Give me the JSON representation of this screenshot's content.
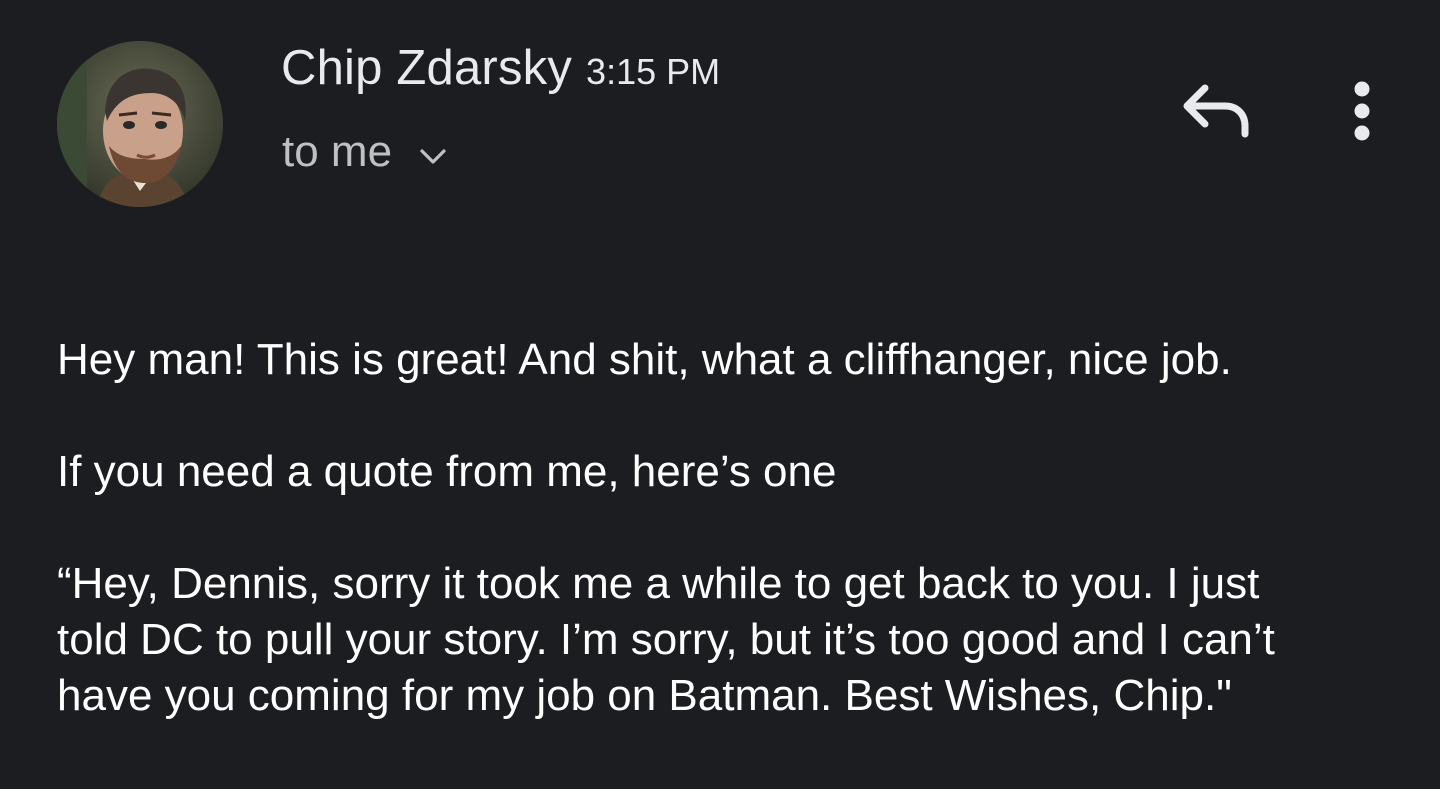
{
  "header": {
    "sender_name": "Chip Zdarsky",
    "time": "3:15 PM",
    "recipient": "to me",
    "avatar_icon": "avatar-photo",
    "chevron_icon": "chevron-down-icon",
    "reply_icon": "reply-icon",
    "more_icon": "more-vertical-icon"
  },
  "message": {
    "paragraph_1": "Hey man! This is great! And shit, what a cliffhanger, nice job.",
    "paragraph_2": "If you need a quote from me, here’s one",
    "paragraph_3_line_1": "“Hey, Dennis, sorry it took me a while to get back to you. I just",
    "paragraph_3_line_2": "told DC to pull your story. I’m sorry, but it’s too good and I can’t",
    "paragraph_3_line_3": "have you coming for my job on Batman. Best Wishes, Chip.\""
  },
  "colors": {
    "background": "#1c1d20",
    "primary_text": "#ffffff",
    "secondary_text": "#bdc1c6",
    "icon": "#e8eaed"
  }
}
